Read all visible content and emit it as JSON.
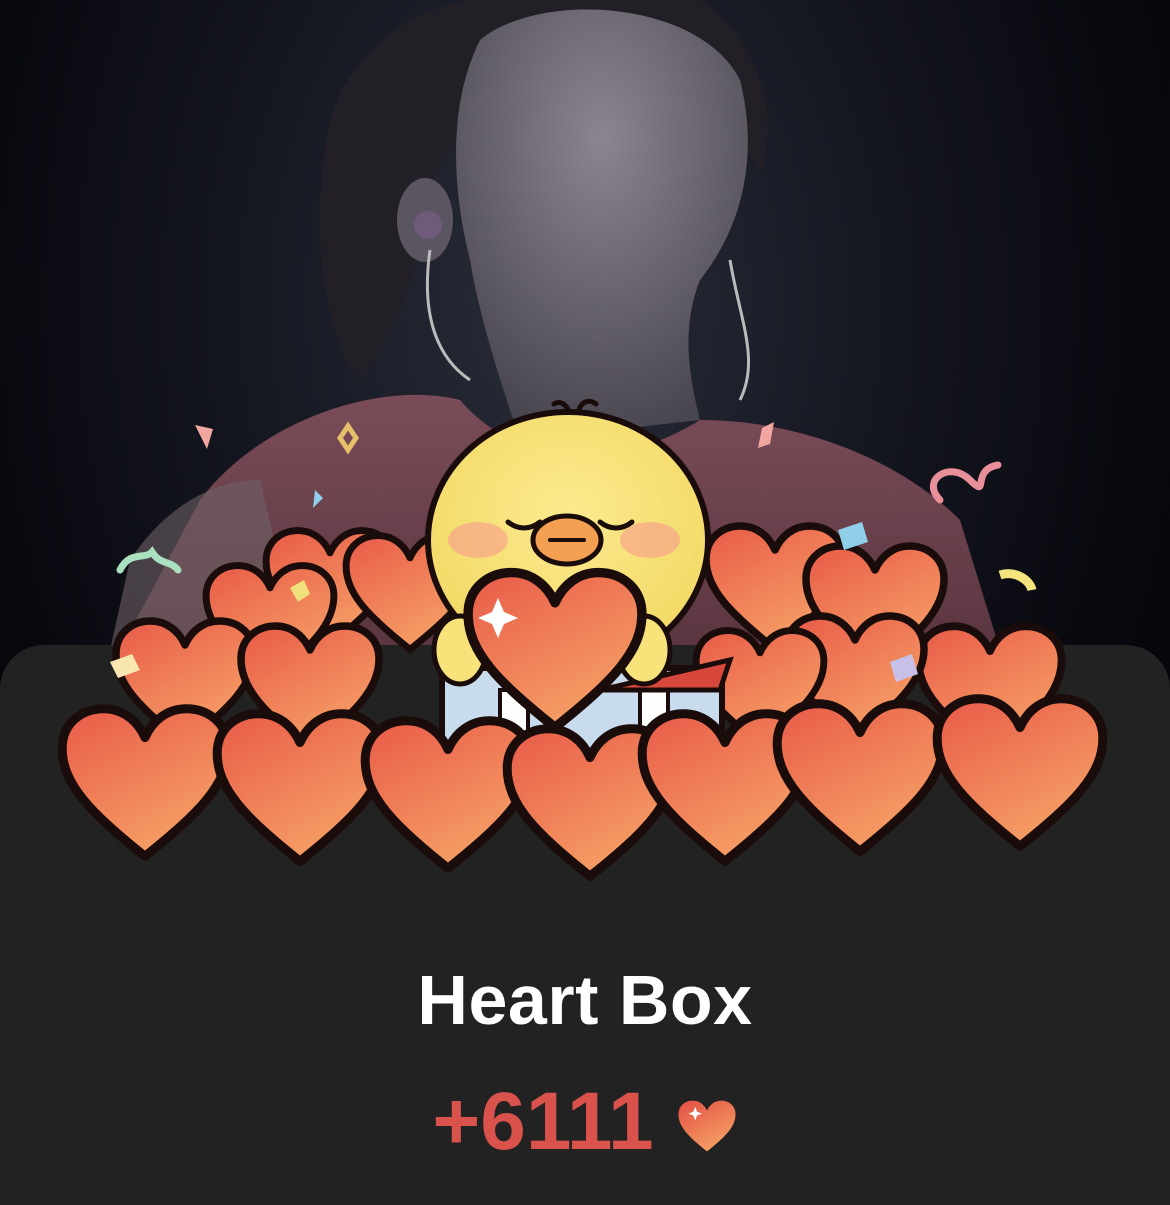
{
  "modal": {
    "title": "Heart Box",
    "reward_amount": "+6111"
  },
  "icons": {
    "reward": "heart-icon",
    "mascot": "chick-mascot"
  },
  "colors": {
    "sheet_background": "#222222",
    "reward_text": "#d9534c",
    "heart_fill_top": "#e85a48",
    "heart_fill_bottom": "#f6a066",
    "outline": "#1a0c0a",
    "chick": "#f8e27a"
  }
}
